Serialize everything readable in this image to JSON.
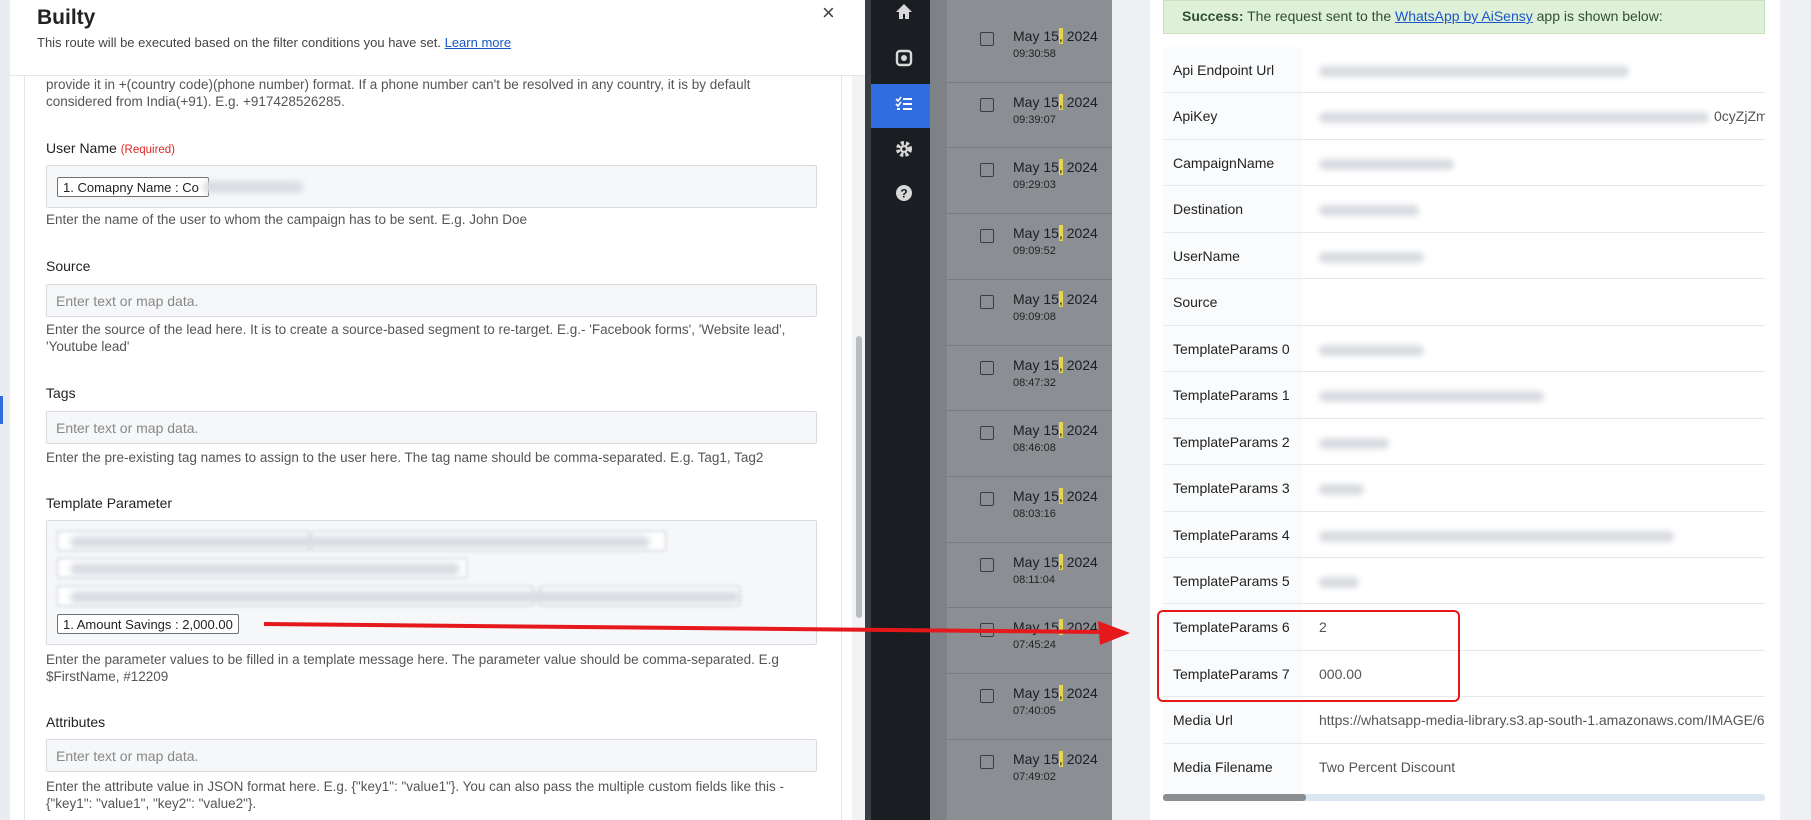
{
  "modal": {
    "title": "Builty",
    "subtitle": "This route will be executed based on the filter conditions you have set.",
    "learn_more": "Learn more",
    "close": "×"
  },
  "form": {
    "phone_help": "provide it in +(country code)(phone number) format. If a phone number can't be resolved in any country, it is by default considered from India(+91). E.g. +917428526285.",
    "user_name": {
      "label": "User Name",
      "required": "(Required)",
      "chip": "1. Comapny Name : Co",
      "help": "Enter the name of the user to whom the campaign has to be sent. E.g. John Doe"
    },
    "source": {
      "label": "Source",
      "placeholder": "Enter text or map data.",
      "help": "Enter the source of the lead here. It is to create a source-based segment to re-target. E.g.- 'Facebook forms', 'Website lead', 'Youtube lead'"
    },
    "tags": {
      "label": "Tags",
      "placeholder": "Enter text or map data.",
      "help": "Enter the pre-existing tag names to assign to the user here. The tag name should be comma-separated. E.g. Tag1, Tag2"
    },
    "template_parameter": {
      "label": "Template Parameter",
      "chip": "1. Amount Savings : 2,000.00",
      "help": "Enter the parameter values to be filled in a template message here. The parameter value should be comma-separated. E.g $FirstName, #12209"
    },
    "attributes": {
      "label": "Attributes",
      "placeholder": "Enter text or map data.",
      "help": "Enter the attribute value in JSON format here. E.g. {\"key1\": \"value1\"}. You can also pass the multiple custom fields like this - {\"key1\": \"value1\", \"key2\": \"value2\"}."
    }
  },
  "sidebar": {
    "icons": [
      "home-icon",
      "integration-icon",
      "task-history-icon",
      "settings-icon",
      "help-icon"
    ]
  },
  "history": {
    "rows": [
      {
        "date_pre": "May 15",
        "date_hl": ",",
        "date_post": " 2024",
        "time": "09:30:58"
      },
      {
        "date_pre": "May 15",
        "date_hl": ",",
        "date_post": " 2024",
        "time": "09:39:07"
      },
      {
        "date_pre": "May 15",
        "date_hl": ",",
        "date_post": " 2024",
        "time": "09:29:03"
      },
      {
        "date_pre": "May 15",
        "date_hl": ",",
        "date_post": " 2024",
        "time": "09:09:52"
      },
      {
        "date_pre": "May 15",
        "date_hl": ",",
        "date_post": " 2024",
        "time": "09:09:08"
      },
      {
        "date_pre": "May 15",
        "date_hl": ",",
        "date_post": " 2024",
        "time": "08:47:32"
      },
      {
        "date_pre": "May 15",
        "date_hl": ",",
        "date_post": " 2024",
        "time": "08:46:08"
      },
      {
        "date_pre": "May 15",
        "date_hl": ",",
        "date_post": " 2024",
        "time": "08:03:16"
      },
      {
        "date_pre": "May 15",
        "date_hl": ",",
        "date_post": " 2024",
        "time": "08:11:04"
      },
      {
        "date_pre": "May 15",
        "date_hl": ",",
        "date_post": " 2024",
        "time": "07:45:24"
      },
      {
        "date_pre": "May 15",
        "date_hl": ",",
        "date_post": " 2024",
        "time": "07:40:05"
      },
      {
        "date_pre": "May 15",
        "date_hl": ",",
        "date_post": " 2024",
        "time": "07:49:02"
      }
    ]
  },
  "response": {
    "success_strong": "Success:",
    "success_text_1": " The request sent to the ",
    "success_link": "WhatsApp by AiSensy",
    "success_text_2": " app is shown below:",
    "rows": [
      {
        "key": "Api Endpoint Url",
        "value": ""
      },
      {
        "key": "ApiKey",
        "value": "0cyZjZm"
      },
      {
        "key": "CampaignName",
        "value": ""
      },
      {
        "key": "Destination",
        "value": ""
      },
      {
        "key": "UserName",
        "value": ""
      },
      {
        "key": "Source",
        "value": ""
      },
      {
        "key": "TemplateParams 0",
        "value": ""
      },
      {
        "key": "TemplateParams 1",
        "value": ""
      },
      {
        "key": "TemplateParams 2",
        "value": ""
      },
      {
        "key": "TemplateParams 3",
        "value": ""
      },
      {
        "key": "TemplateParams 4",
        "value": ""
      },
      {
        "key": "TemplateParams 5",
        "value": ""
      },
      {
        "key": "TemplateParams 6",
        "value": "2"
      },
      {
        "key": "TemplateParams 7",
        "value": "000.00"
      },
      {
        "key": "Media Url",
        "value": "https://whatsapp-media-library.s3.ap-south-1.amazonaws.com/IMAGE/6"
      },
      {
        "key": "Media Filename",
        "value": "Two Percent Discount"
      }
    ]
  },
  "colors": {
    "accent": "#2f6de1",
    "annotation": "#e5181c",
    "success_bg": "#dff0d8"
  }
}
